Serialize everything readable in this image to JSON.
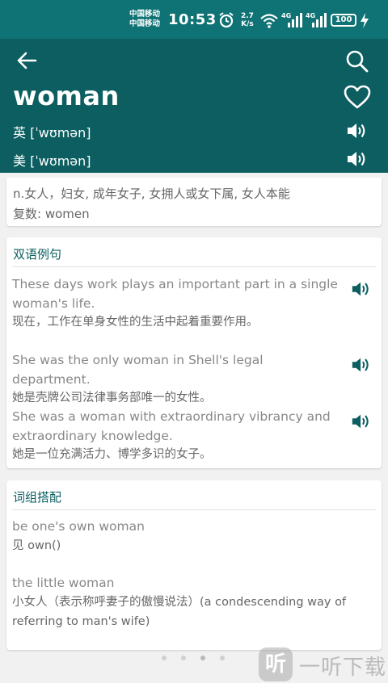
{
  "status_bar": {
    "carrier_1": "中国移动",
    "carrier_2": "中国移动",
    "time": "10:53",
    "net_speed_value": "2.7",
    "net_speed_unit": "K/s",
    "battery": "100",
    "icons": [
      "alarm-icon",
      "wifi-icon",
      "signal-4g-icon",
      "signal-4g-icon",
      "battery-icon",
      "charging-icon"
    ]
  },
  "header": {
    "word": "woman",
    "uk_phonetic": "英 [ˈwʊmən]",
    "us_phonetic": "美 [ˈwʊmən]",
    "background_color": "#0c5e61"
  },
  "definition": {
    "line1": "n.女人，妇女, 成年女子, 女拥人或女下属, 女人本能",
    "line2": "复数: women"
  },
  "examples": {
    "title": "双语例句",
    "items": [
      {
        "en": "These days work plays an important part in a single woman's life.",
        "zh": "现在，工作在单身女性的生活中起着重要作用。"
      },
      {
        "en": "She was the only woman in Shell's legal department.",
        "zh": "她是壳牌公司法律事务部唯一的女性。"
      },
      {
        "en": "She was a woman with extraordinary vibrancy and extraordinary knowledge.",
        "zh": "她是一位充满活力、博学多识的女子。"
      }
    ]
  },
  "phrases": {
    "title": "词组搭配",
    "items": [
      {
        "en": "be one's own woman",
        "zh": "见 own()"
      },
      {
        "en": "the little woman",
        "zh": "小女人（表示称呼妻子的傲慢说法）(a condescending way of referring to man's wife)"
      }
    ]
  },
  "watermark": {
    "logo": "听",
    "text": "一听下载"
  }
}
